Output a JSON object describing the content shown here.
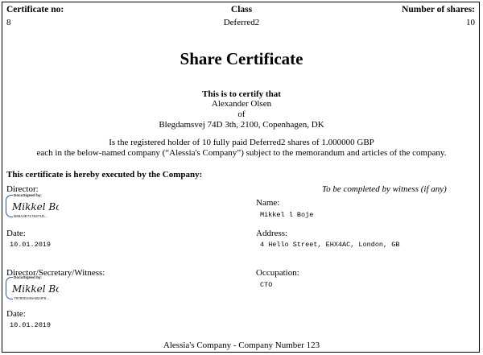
{
  "header": {
    "certificate_no_label": "Certificate no:",
    "certificate_no_value": "8",
    "class_label": "Class",
    "class_value": "Deferred2",
    "shares_label": "Number of shares:",
    "shares_value": "10"
  },
  "title": "Share Certificate",
  "certify": {
    "heading": "This is to certify that",
    "holder_name": "Alexander Olsen",
    "of": "of",
    "holder_address": "Blegdamsvej 74D 3th, 2100, Copenhagen, DK",
    "line1": "Is the registered holder of 10 fully paid Deferred2 shares of 1.000000 GBP",
    "line2": "each in the below-named company (“Alessia's Company”) subject to the memorandum and articles of the company."
  },
  "execution": {
    "heading": "This certificate is hereby executed by the Company:",
    "witness_note": "To be completed by witness (if any)",
    "director_label": "Director:",
    "director_sig": {
      "caption": "DocuSigned by:",
      "signature_text": "Mikkel Boje",
      "envelope_id": "B88A3E7176274D..."
    },
    "date1_label": "Date:",
    "date1_value": "10.01.2019",
    "secretary_label": "Director/Secretary/Witness:",
    "secretary_sig": {
      "caption": "DocuSigned by:",
      "signature_text": "Mikkel Boje",
      "envelope_id": "78780D348AB24F8..."
    },
    "date2_label": "Date:",
    "date2_value": "10.01.2019",
    "name_label": "Name:",
    "name_value": "Mikkel l Boje",
    "address_label": "Address:",
    "address_value": "4 Hello Street, EHX4AC, London, GB",
    "occupation_label": "Occupation:",
    "occupation_value": "CTO"
  },
  "footer": "Alessia's Company - Company Number 123",
  "colors": {
    "signature_blue": "#2b5aa8"
  }
}
